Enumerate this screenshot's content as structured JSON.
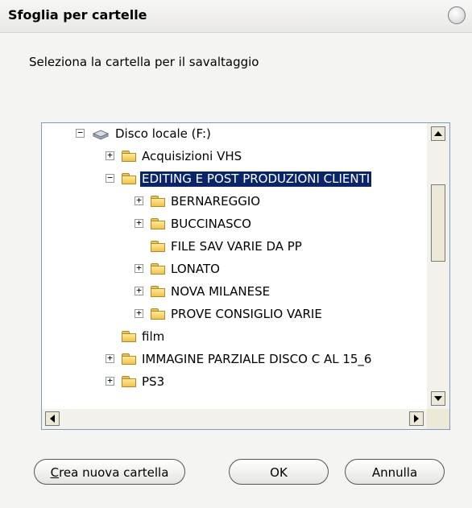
{
  "window": {
    "title": "Sfoglia per cartelle"
  },
  "prompt": "Seleziona la cartella per il savaltaggio",
  "tree": [
    {
      "label": "Disco locale (F:)",
      "level": 0,
      "expander": "minus",
      "icon": "drive-icon",
      "selected": false
    },
    {
      "label": "Acquisizioni VHS",
      "level": 1,
      "expander": "plus",
      "icon": "folder-icon",
      "selected": false
    },
    {
      "label": "EDITING E POST PRODUZIONI CLIENTI",
      "level": 1,
      "expander": "minus",
      "icon": "folder-open-icon",
      "selected": true
    },
    {
      "label": "BERNAREGGIO",
      "level": 2,
      "expander": "plus",
      "icon": "folder-icon",
      "selected": false
    },
    {
      "label": "BUCCINASCO",
      "level": 2,
      "expander": "plus",
      "icon": "folder-icon",
      "selected": false
    },
    {
      "label": "FILE SAV VARIE DA PP",
      "level": 2,
      "expander": "",
      "icon": "folder-icon",
      "selected": false
    },
    {
      "label": "LONATO",
      "level": 2,
      "expander": "plus",
      "icon": "folder-icon",
      "selected": false
    },
    {
      "label": "NOVA MILANESE",
      "level": 2,
      "expander": "plus",
      "icon": "folder-icon",
      "selected": false
    },
    {
      "label": "PROVE CONSIGLIO VARIE",
      "level": 2,
      "expander": "plus",
      "icon": "folder-icon",
      "selected": false
    },
    {
      "label": "film",
      "level": 1,
      "expander": "",
      "icon": "folder-icon",
      "selected": false
    },
    {
      "label": "IMMAGINE PARZIALE DISCO C AL 15_6",
      "level": 1,
      "expander": "plus",
      "icon": "folder-icon",
      "selected": false
    },
    {
      "label": "PS3",
      "level": 1,
      "expander": "plus",
      "icon": "folder-icon",
      "selected": false
    }
  ],
  "buttons": {
    "new_folder_accesskey": "C",
    "new_folder_rest": "rea nuova cartella",
    "ok": "OK",
    "cancel": "Annulla"
  },
  "colors": {
    "selection": "#0a246a",
    "window_bg": "#f4f4f2"
  }
}
